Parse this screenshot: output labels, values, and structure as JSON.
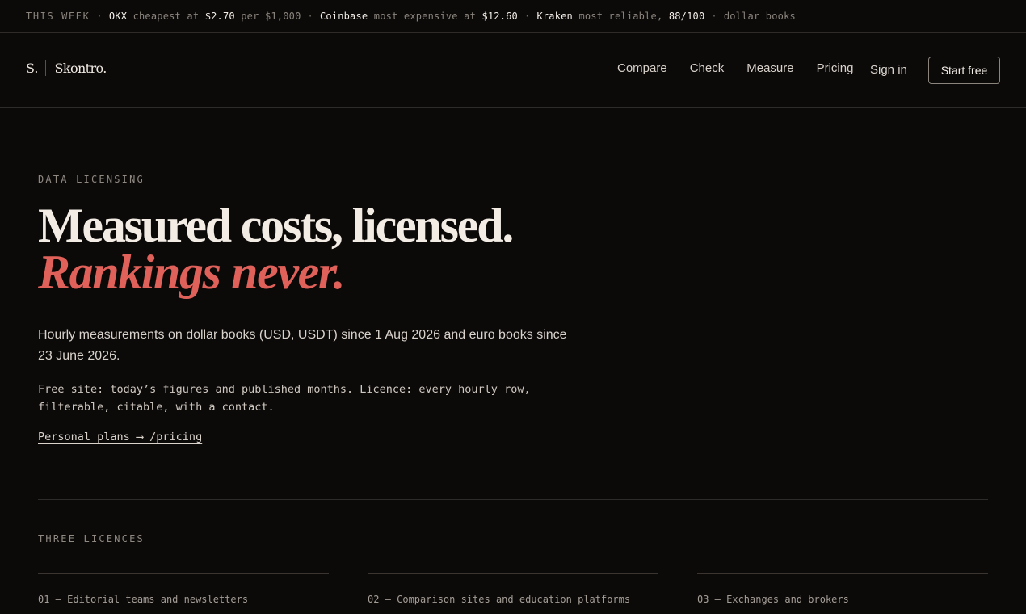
{
  "ticker": {
    "label": "THIS WEEK",
    "items": [
      {
        "name": "OKX",
        "text": "cheapest at",
        "value": "$2.70",
        "suffix": "per $1,000"
      },
      {
        "name": "Coinbase",
        "text": "most expensive at",
        "value": "$12.60"
      },
      {
        "name": "Kraken",
        "text": "most reliable,",
        "value": "88/100"
      }
    ],
    "tail": "dollar books"
  },
  "brand": {
    "mark": "S.",
    "name": "Skontro."
  },
  "nav": {
    "items": [
      "Compare",
      "Check",
      "Measure",
      "Pricing"
    ],
    "sign_in": "Sign in",
    "start_free": "Start free"
  },
  "hero": {
    "eyebrow": "DATA LICENSING",
    "headline_main": "Measured costs, licensed.",
    "headline_accent": "Rankings never.",
    "lede": "Hourly measurements on dollar books (USD, USDT) since 1 Aug 2026 and euro books since 23 June 2026.",
    "note": "Free site: today’s figures and published months. Licence: every hourly row, filterable, citable, with a contact.",
    "link": "Personal plans ⟶ /pricing"
  },
  "licences": {
    "label": "THREE LICENCES",
    "items": [
      "01 — Editorial teams and newsletters",
      "02 — Comparison sites and education platforms",
      "03 — Exchanges and brokers"
    ]
  },
  "colors": {
    "background": "#0c0a09",
    "accent": "#e0615a",
    "text": "#f2ece5"
  }
}
